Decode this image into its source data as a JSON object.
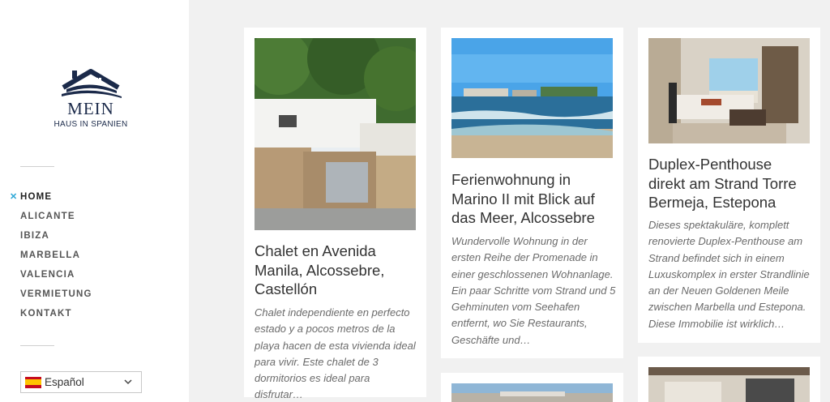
{
  "site": {
    "logo_word": "MEIN",
    "logo_sub": "HAUS IN SPANIEN"
  },
  "nav": {
    "items": [
      {
        "label": "HOME",
        "active": true
      },
      {
        "label": "ALICANTE"
      },
      {
        "label": "IBIZA"
      },
      {
        "label": "MARBELLA"
      },
      {
        "label": "VALENCIA"
      },
      {
        "label": "VERMIETUNG"
      },
      {
        "label": "KONTAKT"
      }
    ]
  },
  "language": {
    "selected": "Español",
    "flag_icon": "spain-flag-icon"
  },
  "posts": [
    {
      "title": "Chalet en Avenida Manila, Alcossebre, Castellón",
      "excerpt": "Chalet independiente en perfecto estado y a pocos metros de la playa hacen de esta vivienda ideal para vivir. Este chalet de 3 dormitorios es ideal para disfrutar…"
    },
    {
      "title": "Ferienwohnung in Marino II mit Blick auf das Meer, Alcossebre",
      "excerpt": "Wundervolle Wohnung in der ersten Reihe der Promenade in einer geschlossenen Wohnanlage. Ein paar Schritte vom Strand und 5 Gehminuten vom Seehafen entfernt, wo Sie Restaurants, Geschäfte und…"
    },
    {
      "title": "Duplex-Penthouse direkt am Strand Torre Bermeja, Estepona",
      "excerpt": "Dieses spektakuläre, komplett renovierte Duplex-Penthouse am Strand befindet sich in einem Luxuskomplex in erster Strandlinie an der Neuen Goldenen Meile zwischen Marbella und Estepona. Diese Immobilie ist wirklich…"
    }
  ],
  "colors": {
    "brand_navy": "#1b2a4a",
    "nav_marker": "#2aa6d6",
    "page_bg": "#f1f1f1"
  }
}
